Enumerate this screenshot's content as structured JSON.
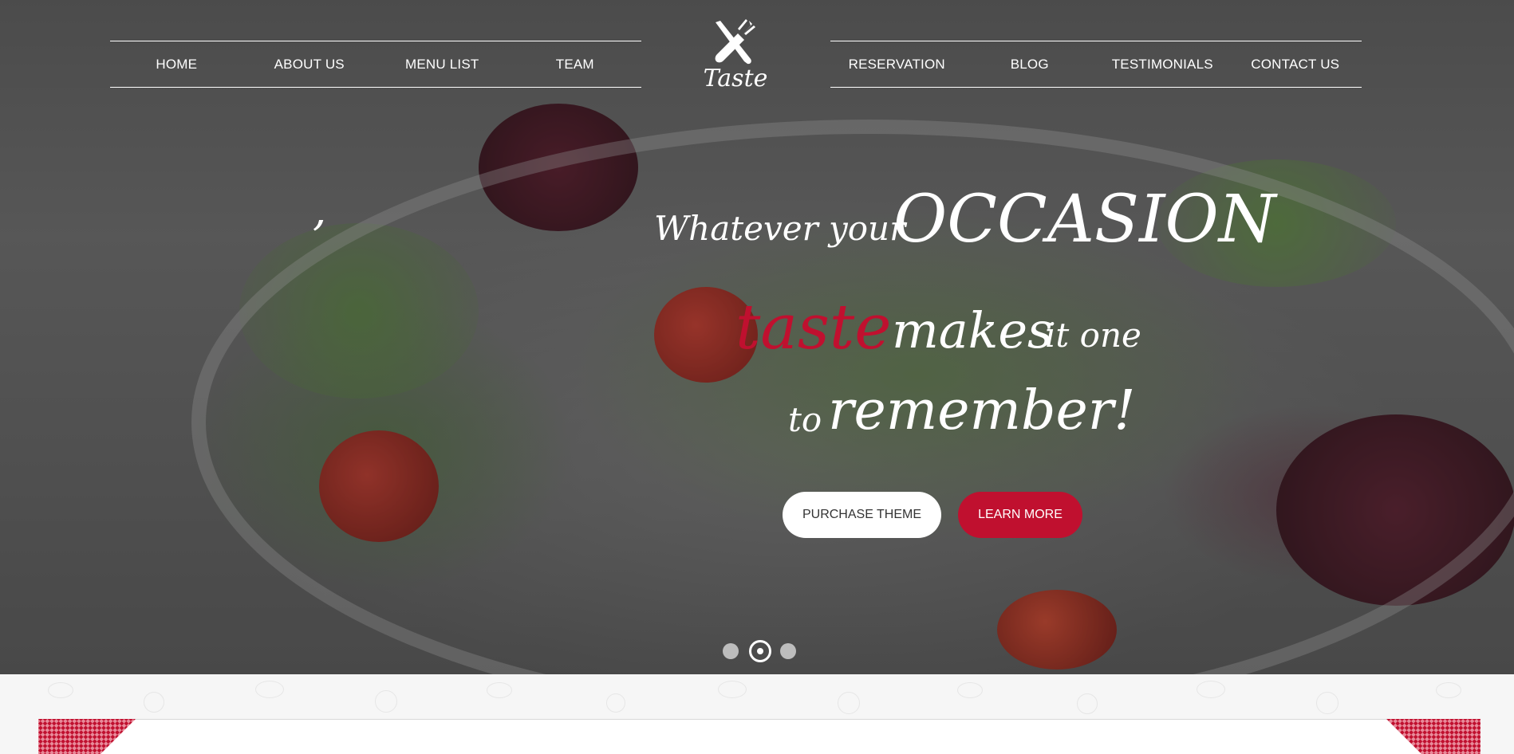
{
  "nav": {
    "left": [
      "HOME",
      "ABOUT US",
      "MENU LIST",
      "TEAM"
    ],
    "right": [
      "RESERVATION",
      "BLOG",
      "TESTIMONIALS",
      "CONTACT US"
    ]
  },
  "logo": {
    "text": "Taste",
    "icon": "fork-knife-icon"
  },
  "hero": {
    "quote_mark": ",",
    "line1_small": "Whatever your",
    "line1_big": "OCCASION",
    "line2_accent": "taste",
    "line2_mid": "makes",
    "line2_small": "it one",
    "line3_small": "to",
    "line3_big": "remember!"
  },
  "buttons": {
    "purchase": "PURCHASE THEME",
    "learn": "LEARN MORE"
  },
  "slider": {
    "total": 3,
    "active": 2
  },
  "colors": {
    "accent": "#c0102f",
    "text": "#ffffff",
    "button_light": "#ffffff"
  }
}
